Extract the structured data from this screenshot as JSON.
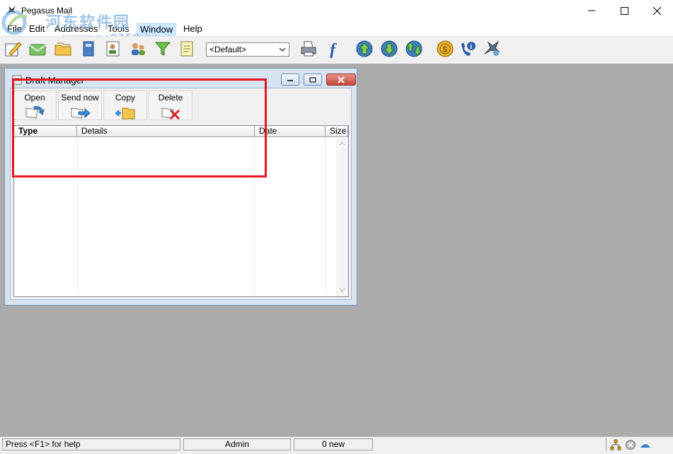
{
  "window": {
    "title": "Pegasus Mail",
    "minimize_symbol": "minimize",
    "maximize_symbol": "maximize",
    "close_symbol": "close"
  },
  "watermark": {
    "text": "河东软件园",
    "url": "www.pc0359.cn"
  },
  "menu": [
    "File",
    "Edit",
    "Addresses",
    "Tools",
    "Window",
    "Help"
  ],
  "toolbar": {
    "identity_value": "<Default>",
    "icons": [
      "new-message-icon",
      "read-mail-icon",
      "folders-icon",
      "address-book-icon",
      "distribution-list-icon",
      "user-list-icon",
      "filter-icon",
      "notepad-icon",
      "print-icon",
      "font-icon",
      "check-mail-icon",
      "receive-mail-icon",
      "send-receive-icon",
      "coins-icon",
      "phone-info-icon",
      "pegasus-icon"
    ]
  },
  "draft_manager": {
    "title": "Draft Manager",
    "actions": [
      {
        "label": "Open",
        "icon": "open-icon"
      },
      {
        "label": "Send now",
        "icon": "send-now-icon"
      },
      {
        "label": "Copy",
        "icon": "copy-icon"
      },
      {
        "label": "Delete",
        "icon": "delete-icon"
      }
    ],
    "columns": [
      "Type",
      "Details",
      "Date",
      "Size"
    ]
  },
  "statusbar": {
    "help": "Press <F1> for help",
    "user": "Admin",
    "new_count": "0 new"
  },
  "colors": {
    "workspace": "#ababab",
    "highlight": "#e8141f",
    "menu_hover": "#cce8ff"
  }
}
